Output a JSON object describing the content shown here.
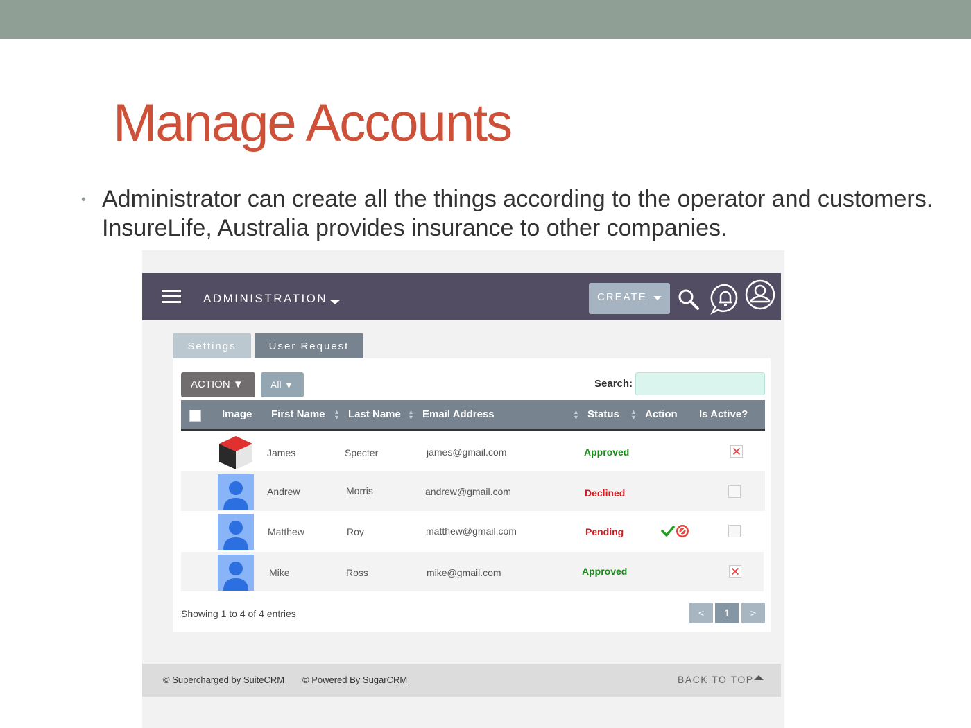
{
  "slide": {
    "title": "Manage Accounts",
    "bullet": "Administrator can create all the things according to the operator and customers. InsureLife, Australia provides insurance to other companies."
  },
  "app": {
    "menu_label": "ADMINISTRATION",
    "create_label": "CREATE",
    "tabs": [
      {
        "label": "Settings"
      },
      {
        "label": "User Request"
      }
    ],
    "action_label": "ACTION ▼",
    "filter_label": "All ▼",
    "search_label": "Search:",
    "search_value": "",
    "columns": {
      "image": "Image",
      "first_name": "First Name",
      "last_name": "Last Name",
      "email": "Email Address",
      "status": "Status",
      "action": "Action",
      "is_active": "Is Active?"
    },
    "rows": [
      {
        "avatar": "suitecrm-cube-icon",
        "first": "James",
        "last": "Specter",
        "email": "james@gmail.com",
        "status": "Approved",
        "status_color": "#1a8a1a",
        "active": true,
        "actions": false
      },
      {
        "avatar": "user-silhouette-icon",
        "first": "Andrew",
        "last": "Morris",
        "email": "andrew@gmail.com",
        "status": "Declined",
        "status_color": "#d8181c",
        "active": false,
        "actions": false
      },
      {
        "avatar": "user-silhouette-icon",
        "first": "Matthew",
        "last": "Roy",
        "email": "matthew@gmail.com",
        "status": "Pending",
        "status_color": "#d8181c",
        "active": false,
        "actions": true
      },
      {
        "avatar": "user-silhouette-icon",
        "first": "Mike",
        "last": "Ross",
        "email": "mike@gmail.com",
        "status": "Approved",
        "status_color": "#1a8a1a",
        "active": true,
        "actions": false
      }
    ],
    "showing": "Showing 1 to 4 of 4 entries",
    "pager": {
      "prev": "<",
      "page": "1",
      "next": ">"
    },
    "footer": {
      "left1": "© Supercharged by SuiteCRM",
      "left2": "© Powered By SugarCRM",
      "back_to_top": "BACK TO TOP"
    },
    "colors": {
      "topbar": "#534d64",
      "table_header": "#77838f",
      "approved": "#1a8a1a",
      "declined": "#d8181c",
      "title": "#cd5138"
    }
  }
}
